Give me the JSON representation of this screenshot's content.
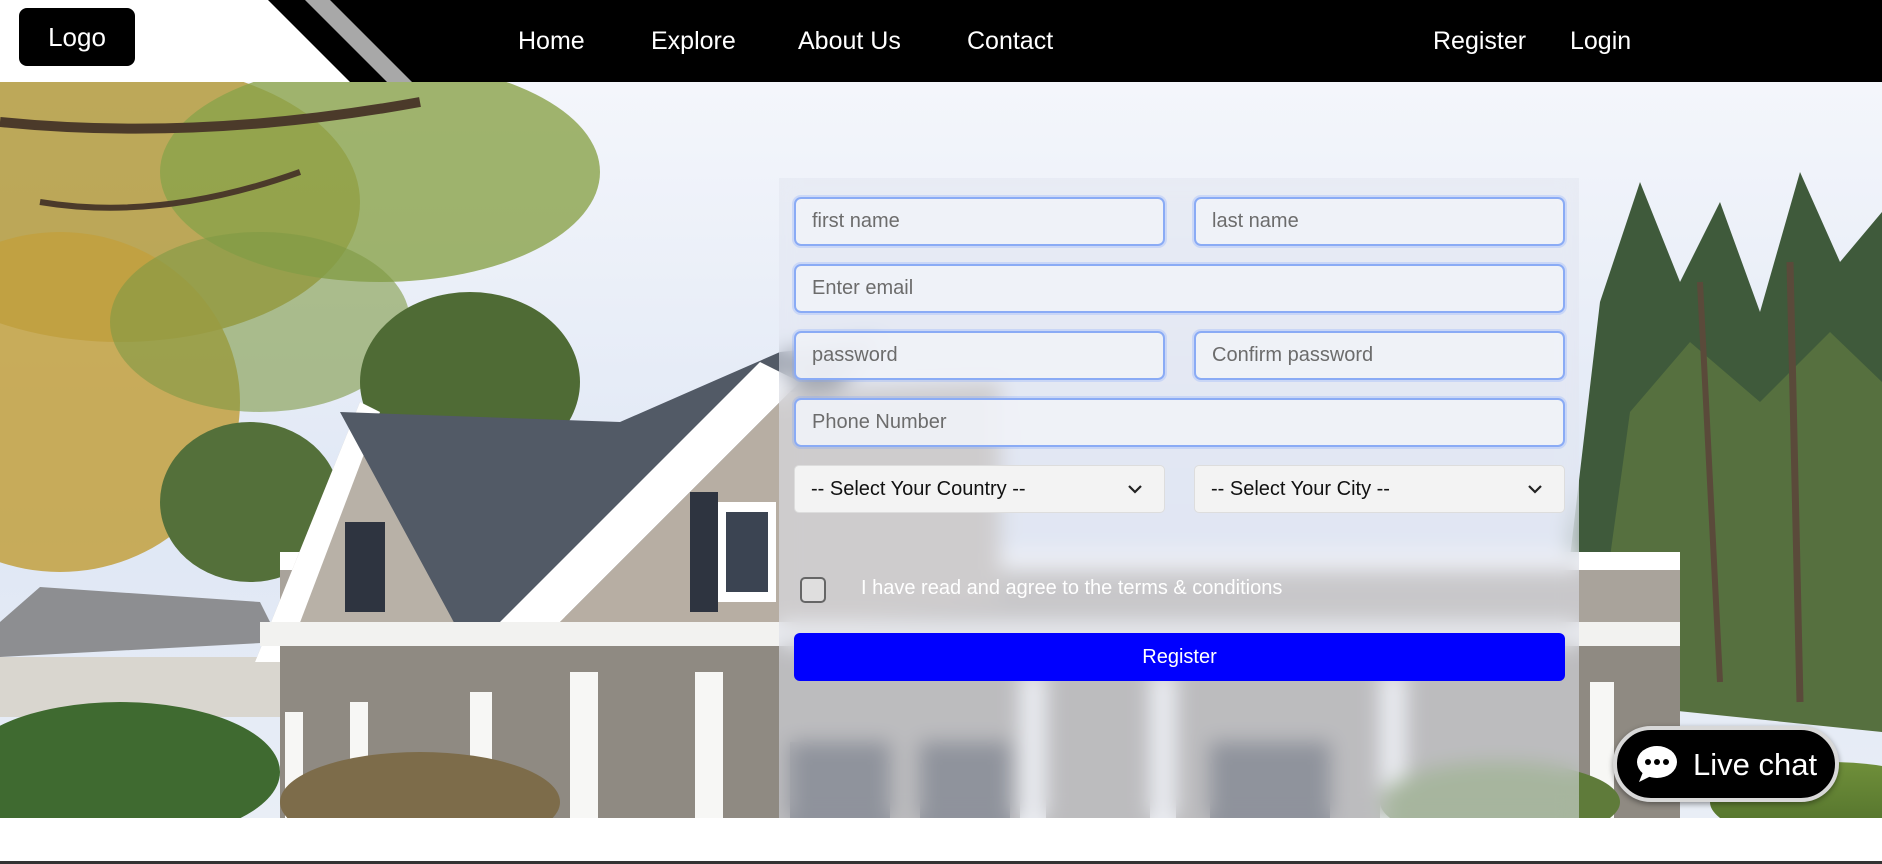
{
  "navbar": {
    "logo": "Logo",
    "links": [
      "Home",
      "Explore",
      "About Us",
      "Contact"
    ],
    "auth": [
      "Register",
      "Login"
    ]
  },
  "form": {
    "first_name_placeholder": "first name",
    "last_name_placeholder": "last name",
    "email_placeholder": "Enter email",
    "password_placeholder": "password",
    "confirm_password_placeholder": "Confirm password",
    "phone_placeholder": "Phone Number",
    "country_select": "-- Select Your Country --",
    "city_select": "-- Select Your City --",
    "terms_label": "I have read and agree to the terms & conditions",
    "terms_checked": false,
    "register_button": "Register"
  },
  "live_chat": {
    "label": "Live chat",
    "icon": "chat-bubble-icon"
  },
  "colors": {
    "navbar": "#000000",
    "primary_button": "#0000ff",
    "field_border": "#8aabf5"
  }
}
